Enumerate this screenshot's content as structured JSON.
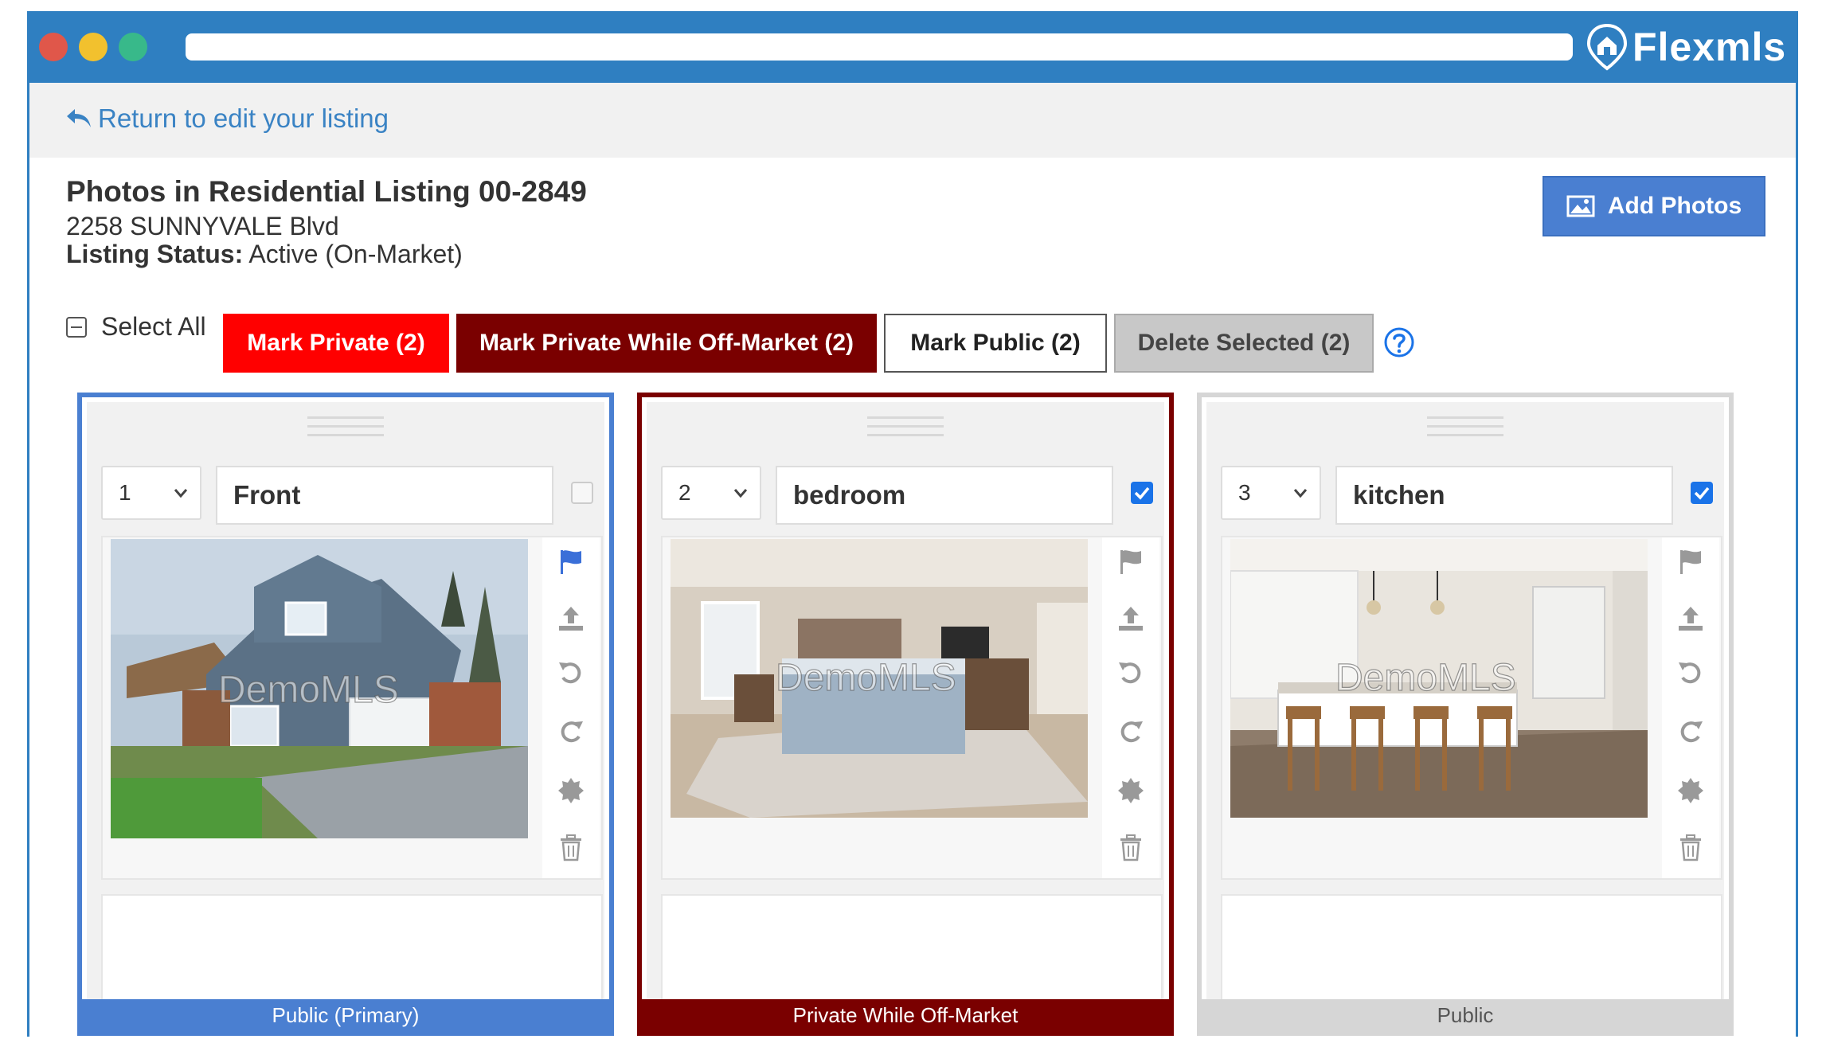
{
  "app": {
    "brand": "Flexmls",
    "title_bar_color": "#2f7fc1"
  },
  "nav": {
    "return_link": "Return to edit your listing"
  },
  "header": {
    "title": "Photos in Residential Listing 00-2849",
    "address": "2258 SUNNYVALE Blvd",
    "status_label": "Listing Status:",
    "status_value": "Active (On-Market)",
    "add_photos_label": "Add Photos"
  },
  "toolbar": {
    "select_all_label": "Select All",
    "mark_private_label": "Mark Private (2)",
    "mark_private_offmarket_label": "Mark Private While Off-Market (2)",
    "mark_public_label": "Mark Public (2)",
    "delete_selected_label": "Delete Selected (2)"
  },
  "colors": {
    "private": "#ff0000",
    "private_offmarket": "#7a0000",
    "public_primary": "#4a7fd1",
    "public": "#d6d6d6",
    "checkbox_checked": "#1a73e8"
  },
  "photos": [
    {
      "order": "1",
      "caption": "Front",
      "checked": false,
      "status": "Public (Primary)",
      "watermark": "DemoMLS",
      "scene": "house-exterior"
    },
    {
      "order": "2",
      "caption": "bedroom",
      "checked": true,
      "status": "Private While Off-Market",
      "watermark": "DemoMLS",
      "scene": "bedroom"
    },
    {
      "order": "3",
      "caption": "kitchen",
      "checked": true,
      "status": "Public",
      "watermark": "DemoMLS",
      "scene": "kitchen"
    }
  ],
  "tool_icons": [
    "flag-icon",
    "upload-icon",
    "rotate-left-icon",
    "rotate-right-icon",
    "settings-icon",
    "trash-icon"
  ]
}
